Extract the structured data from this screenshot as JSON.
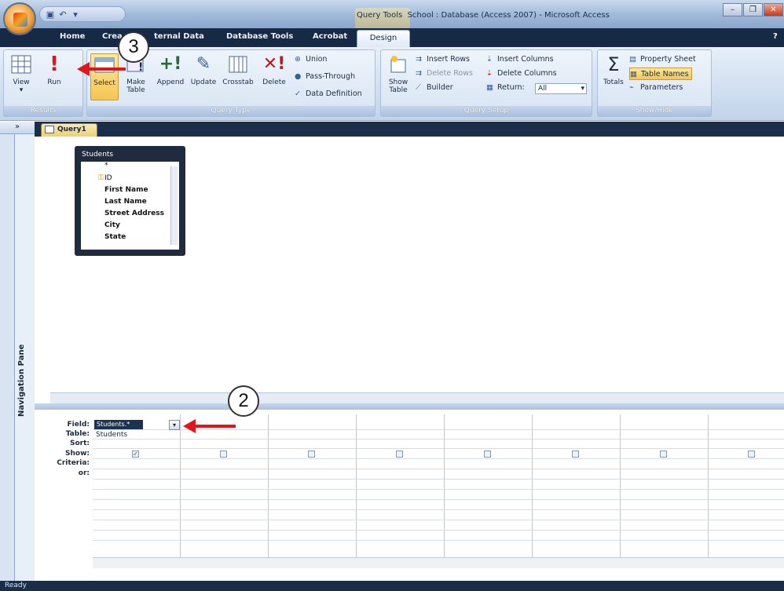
{
  "window": {
    "context_tab": "Query Tools",
    "title": "School : Database (Access 2007) - Microsoft Access"
  },
  "tabs": [
    "Home",
    "Crea",
    "ternal Data",
    "Database Tools",
    "Acrobat",
    "Design"
  ],
  "ribbon": {
    "results": {
      "label": "Results",
      "view": "View",
      "run": "Run"
    },
    "query_type": {
      "label": "Query Type",
      "select": "Select",
      "make_table": "Make Table",
      "append": "Append",
      "update": "Update",
      "crosstab": "Crosstab",
      "delete": "Delete",
      "union": "Union",
      "pass_through": "Pass-Through",
      "data_definition": "Data Definition"
    },
    "query_setup": {
      "label": "Query Setup",
      "show_table": "Show Table",
      "insert_rows": "Insert Rows",
      "delete_rows": "Delete Rows",
      "builder": "Builder",
      "insert_columns": "Insert Columns",
      "delete_columns": "Delete Columns",
      "return_label": "Return:",
      "return_value": "All"
    },
    "show_hide": {
      "label": "Show/Hide",
      "totals": "Totals",
      "property_sheet": "Property Sheet",
      "table_names": "Table Names",
      "parameters": "Parameters"
    }
  },
  "nav_pane": {
    "label": "Navigation Pane",
    "toggle": "»"
  },
  "document_tab": "Query1",
  "table_box": {
    "title": "Students",
    "fields": [
      "*",
      "ID",
      "First Name",
      "Last Name",
      "Street Address",
      "City",
      "State"
    ]
  },
  "grid": {
    "row_labels": [
      "Field:",
      "Table:",
      "Sort:",
      "Show:",
      "Criteria:",
      "or:"
    ],
    "field_value": "Students.*",
    "table_value": "Students"
  },
  "status": "Ready",
  "callouts": {
    "first": "3",
    "second": "2"
  },
  "colors": {
    "arrow": "#e0161a",
    "dark_chrome": "#1a2e4b"
  }
}
